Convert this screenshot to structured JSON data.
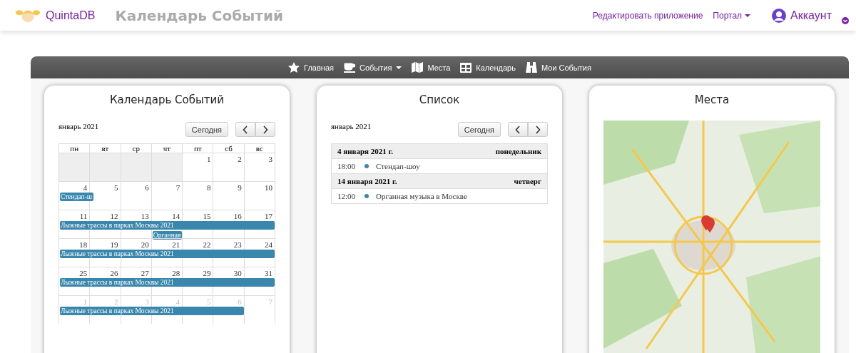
{
  "header": {
    "brand": "QuintaDB",
    "title": "Календарь Событий",
    "links": [
      {
        "label": "Редактировать приложение",
        "dropdown": false
      },
      {
        "label": "Портал",
        "dropdown": true
      }
    ],
    "account": "Аккаунт"
  },
  "nav": [
    {
      "kind": "star",
      "label": "Главная",
      "dropdown": false
    },
    {
      "kind": "cup",
      "label": "События",
      "dropdown": true
    },
    {
      "kind": "map",
      "label": "Места",
      "dropdown": false
    },
    {
      "kind": "grid",
      "label": "Календарь",
      "dropdown": false
    },
    {
      "kind": "binoculars",
      "label": "Мои События",
      "dropdown": false
    }
  ],
  "calendar_card": {
    "title": "Календарь Событий",
    "month": "январь 2021",
    "today_button": "Сегодня",
    "weekdays": [
      "пн",
      "вт",
      "ср",
      "чт",
      "пт",
      "сб",
      "вс"
    ],
    "weeks": [
      {
        "days": [
          {
            "kind": "blank"
          },
          {
            "kind": "blank"
          },
          {
            "kind": "blank"
          },
          {
            "kind": "blank"
          },
          {
            "kind": "day",
            "day": "1",
            "other": false
          },
          {
            "kind": "day",
            "day": "2",
            "other": false
          },
          {
            "kind": "day",
            "day": "3",
            "other": false
          }
        ]
      },
      {
        "days": [
          {
            "kind": "day",
            "day": "4",
            "other": false
          },
          {
            "kind": "day",
            "day": "5",
            "other": false
          },
          {
            "kind": "day",
            "day": "6",
            "other": false
          },
          {
            "kind": "day",
            "day": "7",
            "other": false
          },
          {
            "kind": "day",
            "day": "8",
            "other": false
          },
          {
            "kind": "day",
            "day": "9",
            "other": false
          },
          {
            "kind": "day",
            "day": "10",
            "other": false
          }
        ],
        "lanes": [
          {
            "label": "Стендап-ш",
            "cells": [
              {
                "covered": true
              },
              {
                "covered": false
              },
              {
                "covered": false
              },
              {
                "covered": false
              },
              {
                "covered": false
              },
              {
                "covered": false
              },
              {
                "covered": false
              }
            ]
          }
        ]
      },
      {
        "days": [
          {
            "kind": "day",
            "day": "11",
            "other": false
          },
          {
            "kind": "day",
            "day": "12",
            "other": false
          },
          {
            "kind": "day",
            "day": "13",
            "other": false
          },
          {
            "kind": "day",
            "day": "14",
            "other": false
          },
          {
            "kind": "day",
            "day": "15",
            "other": false
          },
          {
            "kind": "day",
            "day": "16",
            "other": false
          },
          {
            "kind": "day",
            "day": "17",
            "other": false
          }
        ],
        "lanes": [
          {
            "label": "Лыжные трассы в парках Москвы 2021",
            "cells": [
              {
                "covered": true
              },
              {
                "covered": true
              },
              {
                "covered": true
              },
              {
                "covered": true
              },
              {
                "covered": true
              },
              {
                "covered": true
              },
              {
                "covered": true
              }
            ]
          },
          {
            "label": "Органная",
            "cells": [
              {
                "covered": false
              },
              {
                "covered": false
              },
              {
                "covered": false
              },
              {
                "covered": true
              },
              {
                "covered": false
              },
              {
                "covered": false
              },
              {
                "covered": false
              }
            ]
          }
        ]
      },
      {
        "days": [
          {
            "kind": "day",
            "day": "18",
            "other": false
          },
          {
            "kind": "day",
            "day": "19",
            "other": false
          },
          {
            "kind": "day",
            "day": "20",
            "other": false
          },
          {
            "kind": "day",
            "day": "21",
            "other": false
          },
          {
            "kind": "day",
            "day": "22",
            "other": false
          },
          {
            "kind": "day",
            "day": "23",
            "other": false
          },
          {
            "kind": "day",
            "day": "24",
            "other": false
          }
        ],
        "lanes": [
          {
            "label": "Лыжные трассы в парках Москвы 2021",
            "cells": [
              {
                "covered": true
              },
              {
                "covered": true
              },
              {
                "covered": true
              },
              {
                "covered": true
              },
              {
                "covered": true
              },
              {
                "covered": true
              },
              {
                "covered": true
              }
            ]
          }
        ]
      },
      {
        "days": [
          {
            "kind": "day",
            "day": "25",
            "other": false
          },
          {
            "kind": "day",
            "day": "26",
            "other": false
          },
          {
            "kind": "day",
            "day": "27",
            "other": false
          },
          {
            "kind": "day",
            "day": "28",
            "other": false
          },
          {
            "kind": "day",
            "day": "29",
            "other": false
          },
          {
            "kind": "day",
            "day": "30",
            "other": false
          },
          {
            "kind": "day",
            "day": "31",
            "other": false
          }
        ],
        "lanes": [
          {
            "label": "Лыжные трассы в парках Москвы 2021",
            "cells": [
              {
                "covered": true
              },
              {
                "covered": true
              },
              {
                "covered": true
              },
              {
                "covered": true
              },
              {
                "covered": true
              },
              {
                "covered": true
              },
              {
                "covered": true
              }
            ]
          }
        ]
      },
      {
        "days": [
          {
            "kind": "day",
            "day": "1",
            "other": true
          },
          {
            "kind": "day",
            "day": "2",
            "other": true
          },
          {
            "kind": "day",
            "day": "3",
            "other": true
          },
          {
            "kind": "day",
            "day": "4",
            "other": true
          },
          {
            "kind": "day",
            "day": "5",
            "other": true
          },
          {
            "kind": "day",
            "day": "6",
            "other": true
          },
          {
            "kind": "day",
            "day": "7",
            "other": true
          }
        ],
        "lanes": [
          {
            "label": "Лыжные трассы в парках Москвы 2021",
            "cells": [
              {
                "covered": true
              },
              {
                "covered": true
              },
              {
                "covered": true
              },
              {
                "covered": true
              },
              {
                "covered": true
              },
              {
                "covered": true
              },
              {
                "covered": false
              }
            ]
          }
        ]
      }
    ]
  },
  "list_card": {
    "title": "Список",
    "month": "январь 2021",
    "today_button": "Сегодня",
    "groups": [
      {
        "date": "4 января 2021 г.",
        "weekday": "понедельник",
        "items": [
          {
            "time": "18:00",
            "title": "Стендап-шоу",
            "color": "#3a87ad"
          }
        ]
      },
      {
        "date": "14 января 2021 г.",
        "weekday": "четверг",
        "items": [
          {
            "time": "12:00",
            "title": "Органная музыка в Москве",
            "color": "#3a87ad"
          }
        ]
      }
    ]
  },
  "map_card": {
    "title": "Места"
  }
}
